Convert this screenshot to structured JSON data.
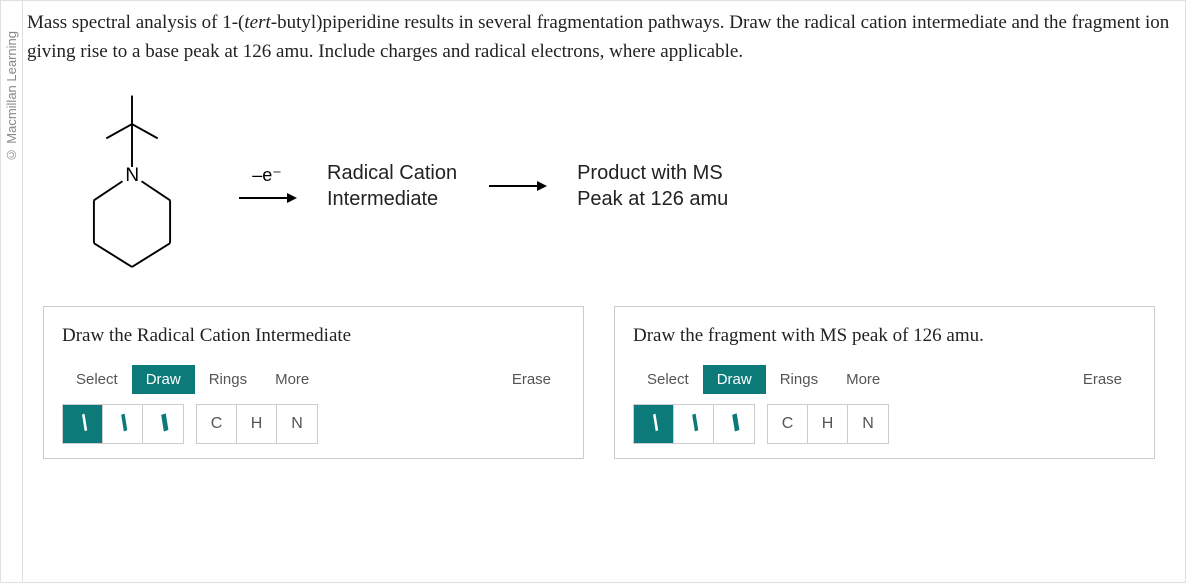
{
  "copyright": "© Macmillan Learning",
  "question": {
    "prefix": "Mass spectral analysis of 1-(",
    "italic": "tert",
    "suffix": "-butyl)piperidine results in several fragmentation pathways. Draw the radical cation intermediate and the fragment ion giving rise to a base peak at 126 amu. Include charges and radical electrons, where applicable."
  },
  "scheme": {
    "electron_loss": "–e⁻",
    "intermediate_label_l1": "Radical Cation",
    "intermediate_label_l2": "Intermediate",
    "product_label_l1": "Product with MS",
    "product_label_l2": "Peak at 126 amu",
    "n_label": "N"
  },
  "panels": {
    "left": {
      "title": "Draw the Radical Cation Intermediate"
    },
    "right": {
      "title": "Draw the fragment with MS peak of 126 amu."
    }
  },
  "toolbar": {
    "select": "Select",
    "draw": "Draw",
    "rings": "Rings",
    "more": "More",
    "erase": "Erase",
    "atoms": {
      "c": "C",
      "h": "H",
      "n": "N"
    }
  }
}
